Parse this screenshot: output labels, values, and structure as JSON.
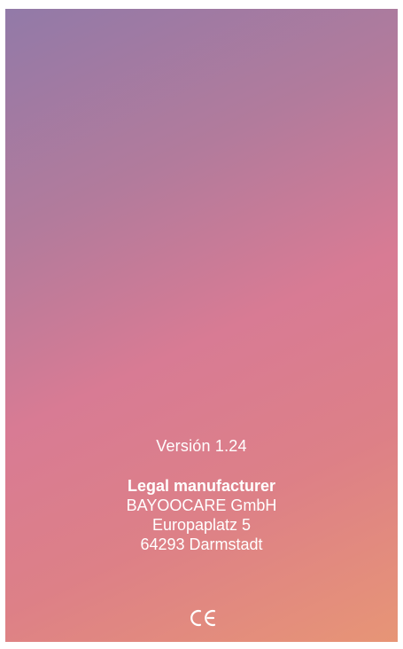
{
  "about": {
    "version": "Versión 1.24",
    "manufacturer": {
      "title": "Legal manufacturer",
      "lines": [
        "BAYOOCARE GmbH",
        "Europaplatz 5",
        "64293 Darmstadt"
      ]
    },
    "certification_mark": "ce-mark-icon"
  },
  "colors": {
    "gradient_top": "#927aa8",
    "gradient_middle": "#d87b94",
    "gradient_bottom": "#e79576",
    "text": "#ffffff"
  }
}
